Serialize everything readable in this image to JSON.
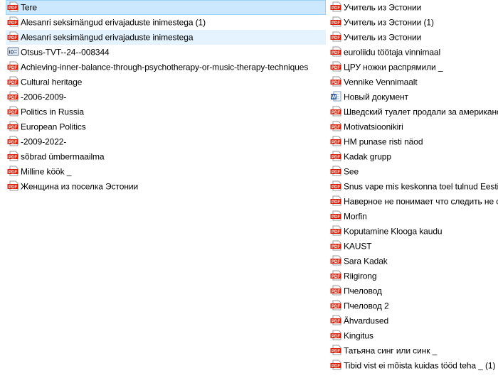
{
  "window": {
    "title": ""
  },
  "colors": {
    "pdf_red": "#d81e06",
    "selection_bg": "#cce8ff",
    "selection_border": "#99d1ff",
    "hover_bg": "#e5f3ff",
    "word_blue": "#2b579a",
    "id_dark": "#1f3864"
  },
  "files": {
    "left": [
      {
        "name": "Tere",
        "icon": "pdf-icon",
        "state": "selected"
      },
      {
        "name": "Alesanri seksimängud erivajaduste inimestega (1)",
        "icon": "pdf-icon",
        "state": ""
      },
      {
        "name": "Alesanri seksimängud erivajaduste inimestega",
        "icon": "pdf-icon",
        "state": "hover"
      },
      {
        "name": "Otsus-TVT--24--008344",
        "icon": "id-card-icon",
        "state": ""
      },
      {
        "name": "Achieving-inner-balance-through-psychotherapy-or-music-therapy-techniques",
        "icon": "pdf-icon",
        "state": ""
      },
      {
        "name": "Cultural heritage",
        "icon": "pdf-icon",
        "state": ""
      },
      {
        "name": "-2006-2009-",
        "icon": "pdf-icon",
        "state": ""
      },
      {
        "name": "Politics in Russia",
        "icon": "pdf-icon",
        "state": ""
      },
      {
        "name": "European Politics",
        "icon": "pdf-icon",
        "state": ""
      },
      {
        "name": "-2009-2022-",
        "icon": "pdf-icon",
        "state": ""
      },
      {
        "name": "sõbrad ümbermaailma",
        "icon": "pdf-icon",
        "state": ""
      },
      {
        "name": "Milline köök _",
        "icon": "pdf-icon",
        "state": ""
      },
      {
        "name": "Женщина из поселка Эстонии",
        "icon": "pdf-icon",
        "state": ""
      }
    ],
    "right": [
      {
        "name": "Учитель из Эстонии",
        "icon": "pdf-icon",
        "state": ""
      },
      {
        "name": "Учитель из Эстонии  (1)",
        "icon": "pdf-icon",
        "state": ""
      },
      {
        "name": "Учитель из Эстонии",
        "icon": "pdf-icon",
        "state": ""
      },
      {
        "name": "euroliidu töötaja vinnimaal",
        "icon": "pdf-icon",
        "state": ""
      },
      {
        "name": "ЦРУ ножки распрямили _",
        "icon": "pdf-icon",
        "state": ""
      },
      {
        "name": "Vennike Vennimaalt",
        "icon": "pdf-icon",
        "state": ""
      },
      {
        "name": "Новый документ",
        "icon": "word-doc-icon",
        "state": ""
      },
      {
        "name": "Шведский туалет продали за американс",
        "icon": "pdf-icon",
        "state": ""
      },
      {
        "name": "Motivatsioonikiri",
        "icon": "pdf-icon",
        "state": ""
      },
      {
        "name": "HM punase risti näod",
        "icon": "pdf-icon",
        "state": ""
      },
      {
        "name": "Kadak grupp",
        "icon": "pdf-icon",
        "state": ""
      },
      {
        "name": "See",
        "icon": "pdf-icon",
        "state": ""
      },
      {
        "name": "Snus vape mis keskonna toel tulnud Eesti_",
        "icon": "pdf-icon",
        "state": ""
      },
      {
        "name": "Наверное не понимает что следить не с",
        "icon": "pdf-icon",
        "state": ""
      },
      {
        "name": "Morfin",
        "icon": "pdf-icon",
        "state": ""
      },
      {
        "name": "Koputamine Klooga kaudu",
        "icon": "pdf-icon",
        "state": ""
      },
      {
        "name": "KAUST",
        "icon": "pdf-icon",
        "state": ""
      },
      {
        "name": "Sara Kadak",
        "icon": "pdf-icon",
        "state": ""
      },
      {
        "name": "Riigirong",
        "icon": "pdf-icon",
        "state": ""
      },
      {
        "name": "Пчеловод",
        "icon": "pdf-icon",
        "state": ""
      },
      {
        "name": "Пчеловод 2",
        "icon": "pdf-icon",
        "state": ""
      },
      {
        "name": "Ähvardused",
        "icon": "pdf-icon",
        "state": ""
      },
      {
        "name": "Kingitus",
        "icon": "pdf-icon",
        "state": ""
      },
      {
        "name": "Татьяна синг или синк _",
        "icon": "pdf-icon",
        "state": ""
      },
      {
        "name": "Tibid vist ei mõista kuidas tööd teha _  (1)",
        "icon": "pdf-icon",
        "state": ""
      }
    ]
  }
}
